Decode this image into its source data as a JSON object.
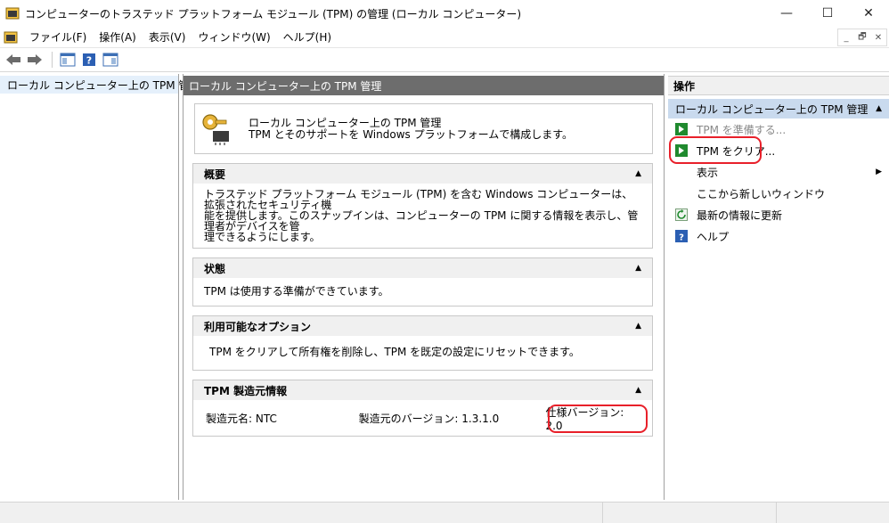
{
  "window": {
    "title": "コンピューターのトラステッド プラットフォーム モジュール (TPM) の管理 (ローカル コンピューター)",
    "minimize": "—",
    "maximize": "☐",
    "close": "✕"
  },
  "menu": {
    "items": [
      "ファイル(F)",
      "操作(A)",
      "表示(V)",
      "ウィンドウ(W)",
      "ヘルプ(H)"
    ],
    "mdi_min": "_",
    "mdi_restore": "🗗",
    "mdi_close": "✕"
  },
  "toolbar": {
    "icons": [
      "back-arrow-icon",
      "forward-arrow-icon",
      "show-hide-console-tree-icon",
      "help-icon",
      "show-hide-action-pane-icon"
    ]
  },
  "tree": {
    "root_label": "ローカル コンピューター上の TPM 管理"
  },
  "center": {
    "header": "ローカル コンピューター上の TPM 管理",
    "intro_line1": "ローカル コンピューター上の TPM 管理",
    "intro_line2": "TPM とそのサポートを Windows プラットフォームで構成します。",
    "overview_title": "概要",
    "overview_line1": "トラステッド プラットフォーム モジュール (TPM) を含む Windows コンピューターは、拡張されたセキュリティ機",
    "overview_line2": "能を提供します。このスナップインは、コンピューターの TPM に関する情報を表示し、管理者がデバイスを管",
    "overview_line3": "理できるようにします。",
    "status_title": "状態",
    "status_text": "TPM は使用する準備ができています。",
    "options_title": "利用可能なオプション",
    "options_text": "TPM をクリアして所有権を削除し、TPM を既定の設定にリセットできます。",
    "mfr_title": "TPM 製造元情報",
    "mfr_name": "製造元名: NTC",
    "mfr_version": "製造元のバージョン: 1.3.1.0",
    "spec_version": "仕様バージョン: 2.0",
    "collapse_arrow": "▲"
  },
  "actions": {
    "title": "操作",
    "subheader": "ローカル コンピューター上の TPM 管理",
    "collapse_arrow": "▲",
    "prepare": "TPM を準備する...",
    "clear": "TPM をクリア...",
    "view": "表示",
    "view_arrow": "▶",
    "new_window": "ここから新しいウィンドウ",
    "refresh": "最新の情報に更新",
    "help": "ヘルプ"
  },
  "colors": {
    "accent_red": "#e8202a",
    "header_gray": "#6d6d6d",
    "selection_blue": "#c9daee",
    "action_green": "#1f8a2e"
  }
}
